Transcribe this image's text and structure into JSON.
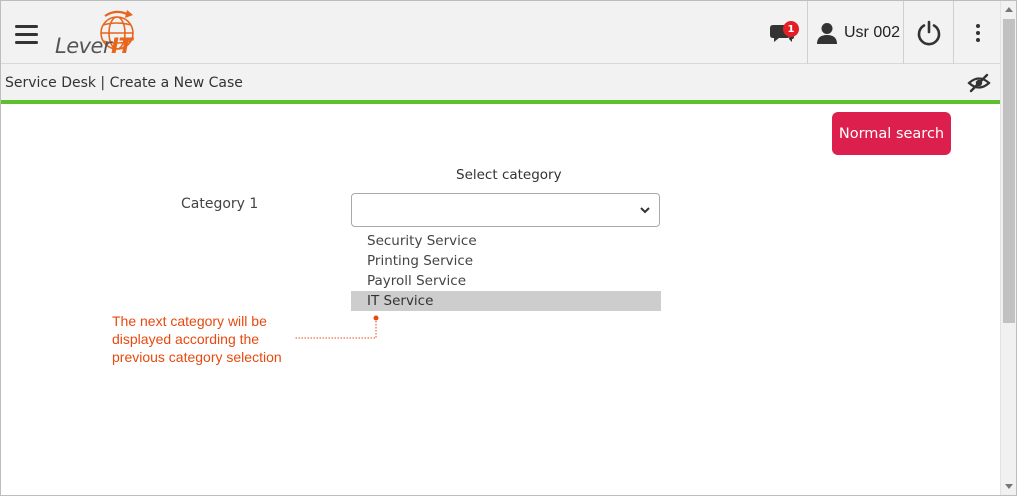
{
  "header": {
    "logo_text": "Lever",
    "logo_accent": "IT",
    "notification_count": "1",
    "user_name": "Usr 002",
    "icons": [
      "menu-icon",
      "chat-icon",
      "user-icon",
      "power-icon",
      "more-vertical-icon"
    ]
  },
  "breadcrumb": {
    "text": "Service Desk | Create a New Case",
    "toggle_icon": "eye-slash-icon"
  },
  "main": {
    "normal_search_label": "Normal search",
    "select_category_label": "Select category",
    "category_label": "Category 1",
    "select_value": "",
    "options": [
      "Security Service",
      "Printing Service",
      "Payroll Service",
      "IT Service"
    ],
    "highlighted_option": "IT Service"
  },
  "annotation": {
    "line1": "The next category will be",
    "line2": "displayed according the",
    "line3": "previous category selection"
  },
  "colors": {
    "accent_green": "#5dc12f",
    "button_red": "#dc1f4d",
    "annotation_orange": "#e8490f",
    "logo_orange": "#e8651d",
    "badge_red": "#e41e26"
  }
}
